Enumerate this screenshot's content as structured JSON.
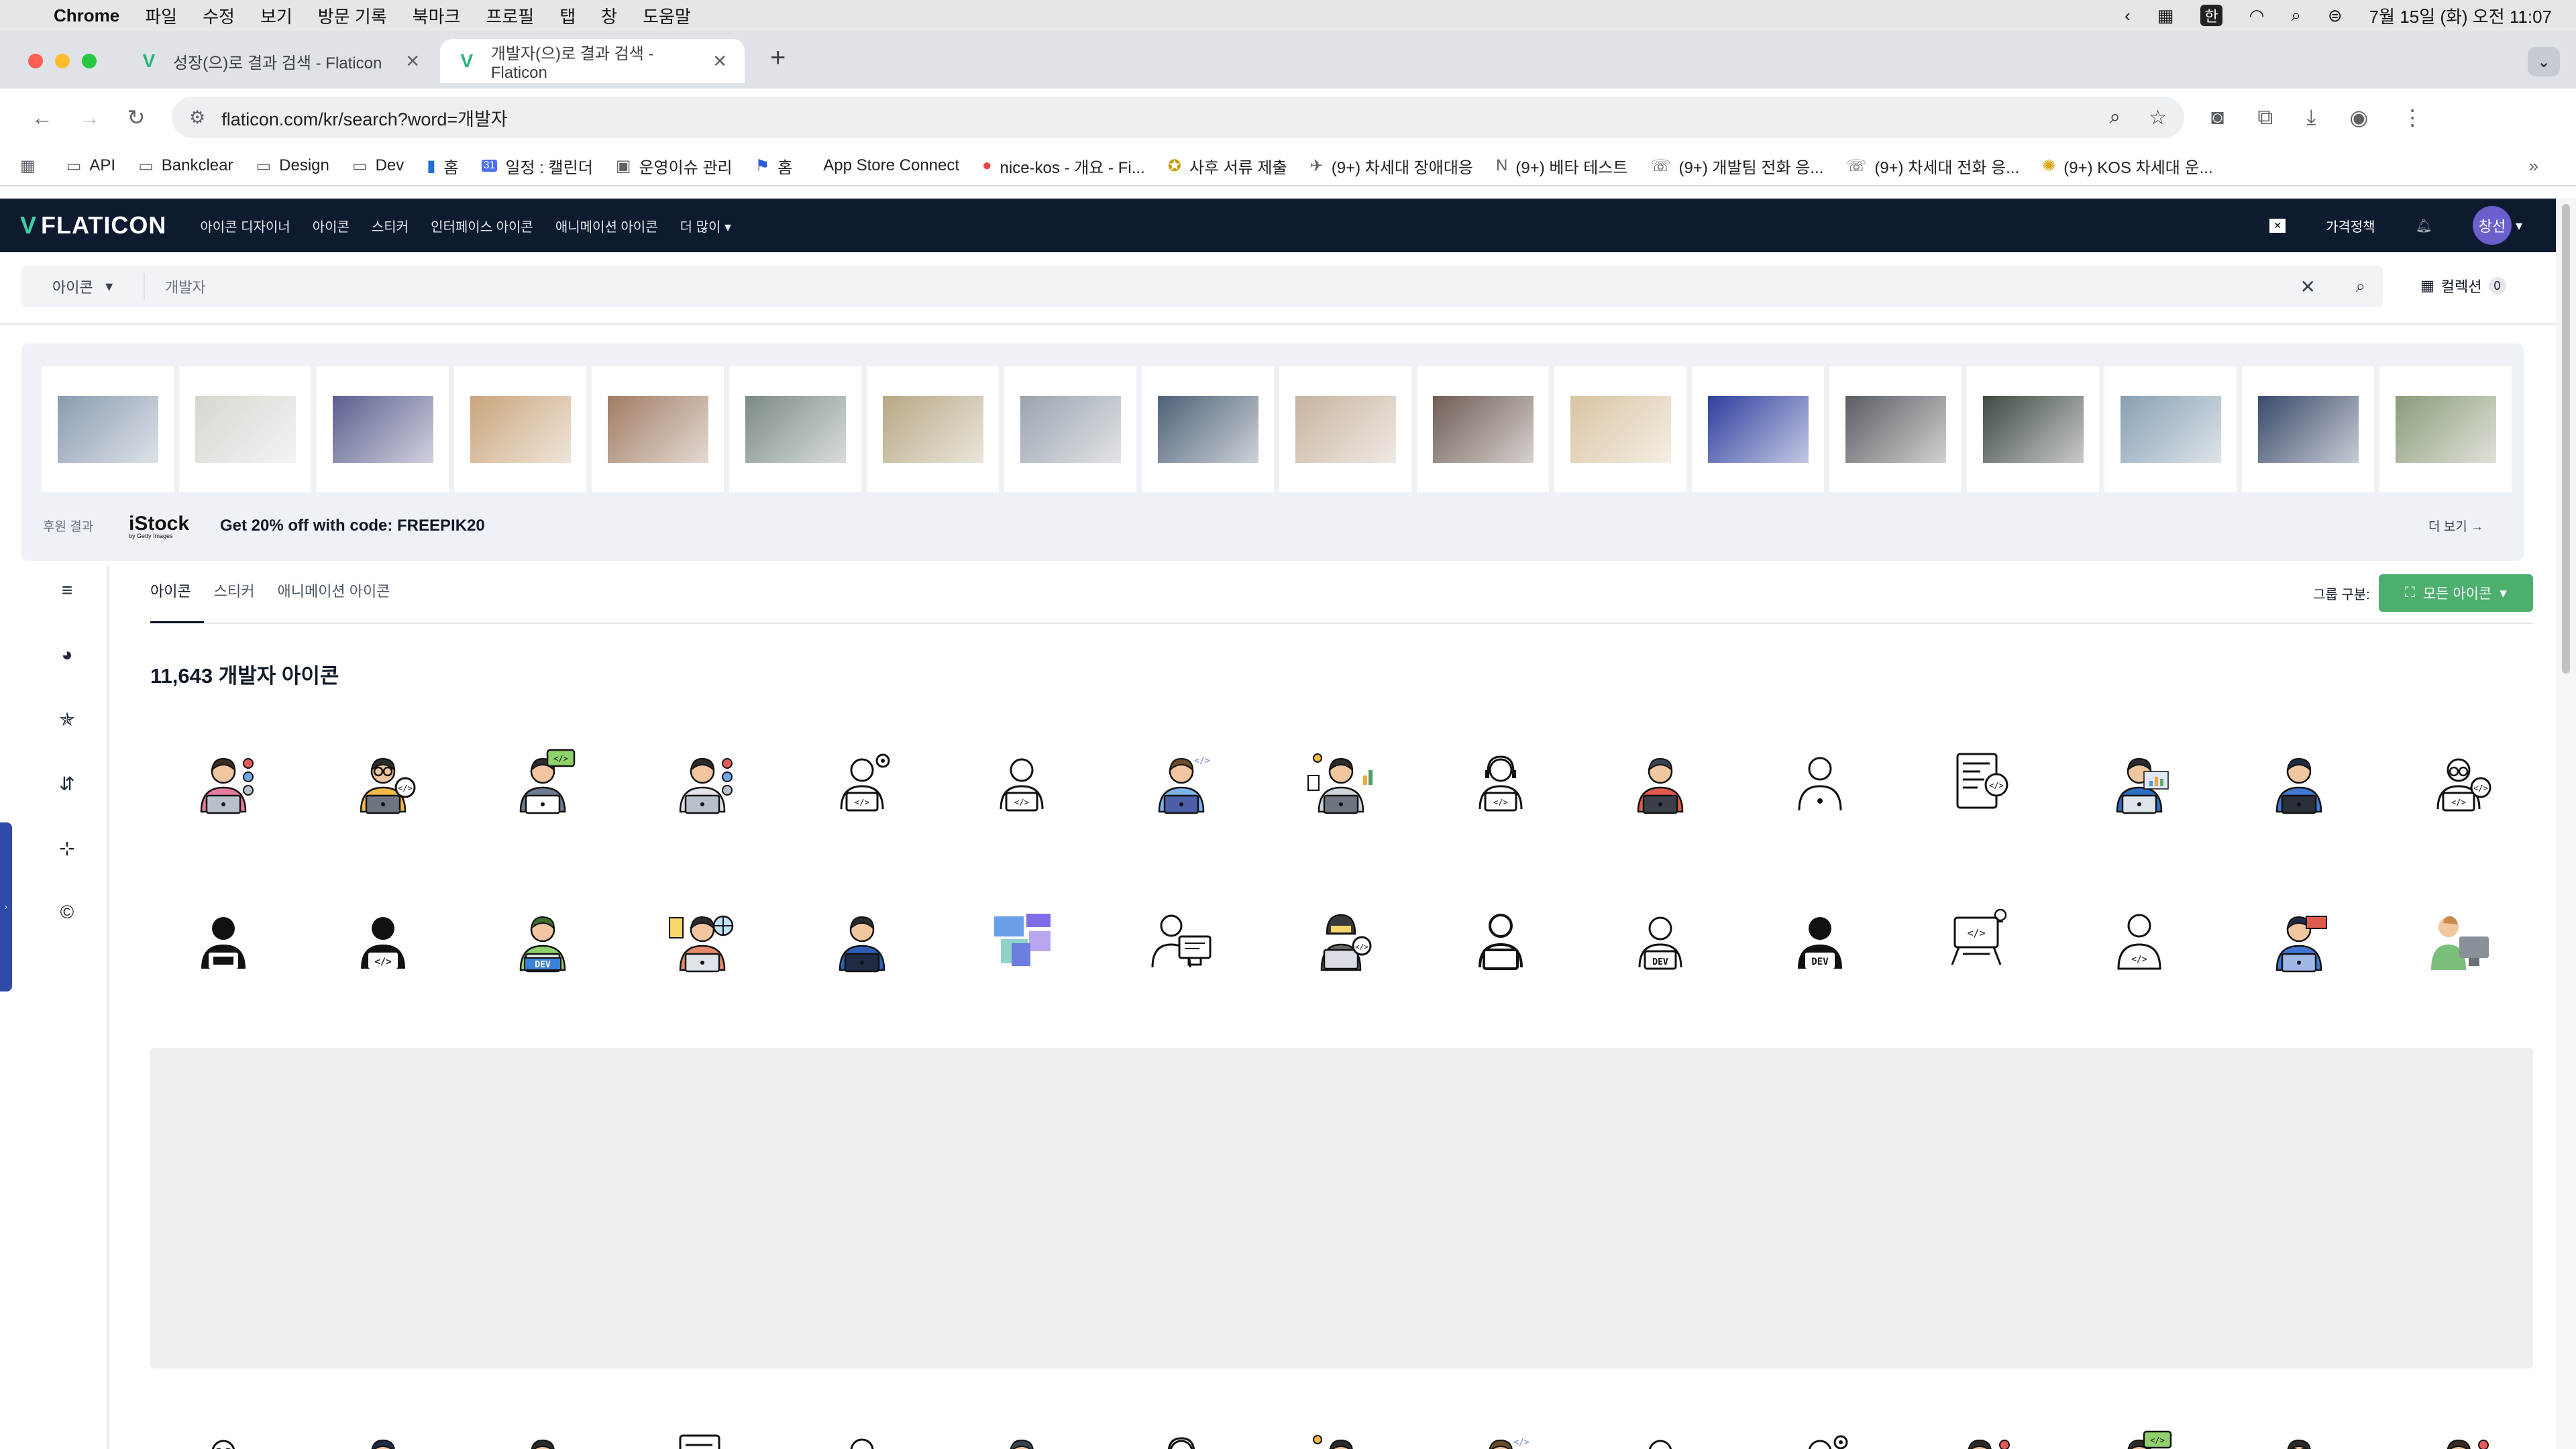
{
  "menubar": {
    "app": "Chrome",
    "items": [
      "파일",
      "수정",
      "보기",
      "방문 기록",
      "북마크",
      "프로필",
      "탭",
      "창",
      "도움말"
    ],
    "ime": "한",
    "clock": "7월 15일 (화) 오전 11:07"
  },
  "tabs": [
    {
      "title": "성장(으)로 결과 검색 - Flaticon"
    },
    {
      "title": "개발자(으)로 결과 검색 - Flaticon"
    }
  ],
  "address": {
    "url": "flaticon.com/kr/search?word=개발자"
  },
  "bookmarks": [
    "API",
    "Bankclear",
    "Design",
    "Dev",
    "홈",
    "일정 : 캘린더",
    "운영이슈 관리",
    "홈",
    "App Store Connect",
    "nice-kos - 개요 - Fi...",
    "사후 서류 제출",
    "(9+) 차세대 장애대응",
    "(9+) 베타 테스트",
    "(9+) 개발팀 전화 응...",
    "(9+) 차세대 전화 응...",
    "(9+) KOS 차세대 운..."
  ],
  "bookmark_calendar_day": "31",
  "flaticon": {
    "logo": "FLATICON",
    "nav": [
      "아이콘 디자이너",
      "아이콘",
      "스티커",
      "인터페이스 아이콘",
      "애니메이션 아이콘",
      "더 많이"
    ],
    "pricing": "가격정책",
    "avatar_text": "창선"
  },
  "search": {
    "type": "아이콘",
    "query": "개발자",
    "collection_label": "컬렉션",
    "collection_count": "0"
  },
  "sponsored": {
    "label": "후원 결과",
    "brand": "iStock",
    "brand_sub": "by Getty Images",
    "promo": "Get 20% off with code: FREEPIK20",
    "see_more": "더 보기"
  },
  "content_tabs": [
    "아이콘",
    "스티커",
    "애니메이션 아이콘"
  ],
  "group": {
    "label": "그룹 구분:",
    "button": "모든 아이콘"
  },
  "results": {
    "title": "11,643 개발자 아이콘"
  },
  "icons_row1": [
    "developer-woman-icon",
    "developer-glasses-icon",
    "developer-code-bubble-icon",
    "developer-tie-icon",
    "developer-gear-outline-icon",
    "developer-laptop-outline-icon",
    "developer-blue-icon",
    "developer-charts-icon",
    "developer-headset-icon",
    "developer-red-hoodie-icon",
    "developer-bust-icon",
    "developer-document-icon",
    "developer-stats-icon",
    "developer-dark-icon",
    "developer-glasses-code-icon"
  ],
  "icons_row2": [
    "developer-silhouette-laptop-icon",
    "developer-silhouette-code-icon",
    "developer-dev-badge-color-icon",
    "developer-globe-icon",
    "developer-monitor-color-icon",
    "developer-dashboard-icon",
    "developer-desk-outline-icon",
    "developer-hacker-icon",
    "developer-minimal-outline-icon",
    "developer-dev-outline-icon",
    "developer-dev-solid-icon",
    "developer-idea-icon",
    "developer-code-outline-icon",
    "developer-monitor-icon",
    "developer-flat-icon"
  ]
}
